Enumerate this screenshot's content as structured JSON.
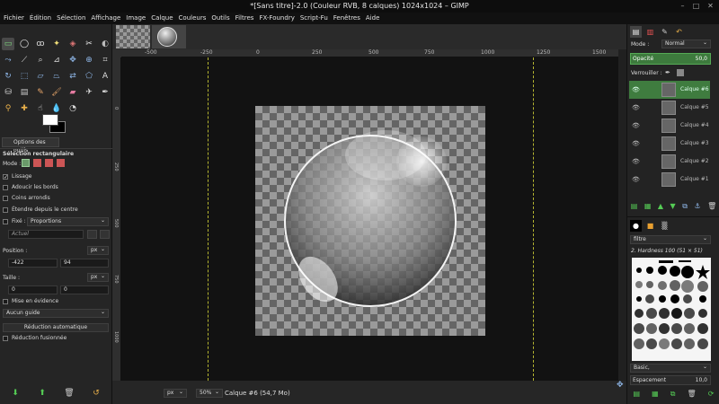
{
  "window": {
    "title": "*[Sans titre]-2.0 (Couleur RVB, 8 calques) 1024x1024 – GIMP"
  },
  "menu": [
    "Fichier",
    "Édition",
    "Sélection",
    "Affichage",
    "Image",
    "Calque",
    "Couleurs",
    "Outils",
    "Filtres",
    "FX-Foundry",
    "Script-Fu",
    "Fenêtres",
    "Aide"
  ],
  "tool_options": {
    "tab_label": "Options des outils",
    "tool_name": "Sélection rectangulaire",
    "mode_label": "Mode :",
    "usage": "Lissage",
    "adoucir": "Adoucir les bords",
    "coins": "Coins arrondis",
    "etendre": "Étendre depuis le centre",
    "fixe": "Fixé :",
    "fixe_value": "Proportions",
    "actuel": "Actuel",
    "position_label": "Position :",
    "position_unit": "px",
    "pos_x": "-422",
    "pos_y": "94",
    "taille_label": "Taille :",
    "taille_unit": "px",
    "size_w": "0",
    "size_h": "0",
    "mise": "Mise en évidence",
    "guide": "Aucun guide",
    "reduction": "Réduction automatique",
    "reduction_fusion": "Réduction fusionnée"
  },
  "ruler_h": [
    "-500",
    "-250",
    "0",
    "250",
    "500",
    "750",
    "1000",
    "1250",
    "1500"
  ],
  "ruler_v": [
    "0",
    "250",
    "500",
    "750",
    "1000"
  ],
  "status": {
    "unit": "px",
    "zoom": "50%",
    "layer_info": "Calque #6 (54,7 Mo)"
  },
  "layers_panel": {
    "mode_label": "Mode :",
    "mode_value": "Normal",
    "opacity_label": "Opacité",
    "opacity_value": "50,0",
    "lock_label": "Verrouiller :",
    "layers": [
      "Calque #6",
      "Calque #5",
      "Calque #4",
      "Calque #3",
      "Calque #2",
      "Calque #1"
    ]
  },
  "brushes_panel": {
    "filter": "filtre",
    "brush_name": "2. Hardness 100 (51 × 51)",
    "tag": "Basic,",
    "spacing_label": "Espacement",
    "spacing_value": "10,0"
  }
}
